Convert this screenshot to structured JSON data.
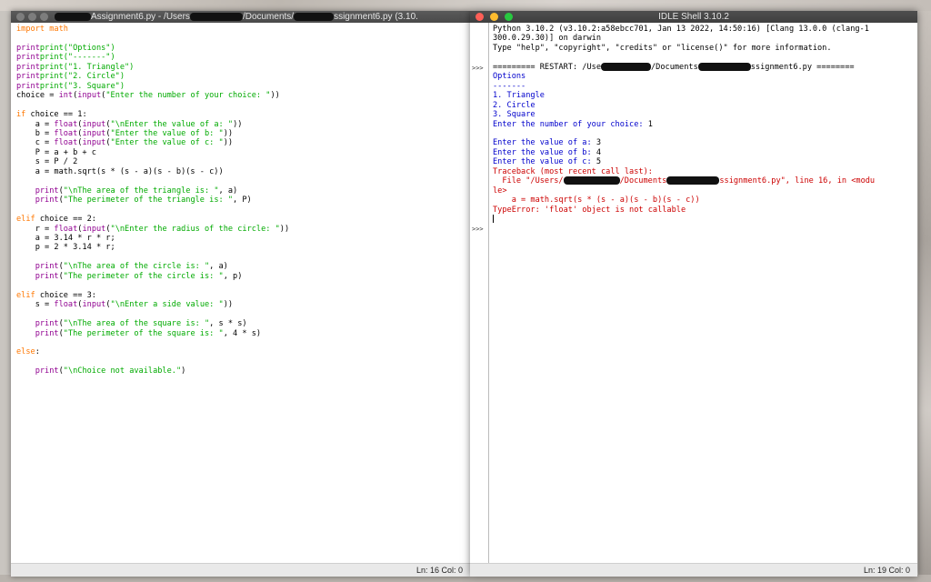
{
  "editor": {
    "title_prefix": "Assignment6.py - /Users",
    "title_mid": "/Documents/",
    "title_suffix": "ssignment6.py (3.10.",
    "status": "Ln: 16  Col: 0",
    "code": {
      "l1": "import math",
      "l2": "print(\"Options\")",
      "l3": "print(\"-------\")",
      "l4": "print(\"1. Triangle\")",
      "l5": "print(\"2. Circle\")",
      "l6": "print(\"3. Square\")",
      "l7_pre": "choice = ",
      "l7_str": "\"Enter the number of your choice: \"",
      "l7_post": "))",
      "l8_cond": " choice == 1:",
      "l9_pre": "    a = ",
      "l9_str": "\"\\nEnter the value of a: \"",
      "l10_pre": "    b = ",
      "l10_str": "\"Enter the value of b: \"",
      "l11_pre": "    c = ",
      "l11_str": "\"Enter the value of c: \"",
      "l12": "    P = a + b + c",
      "l13": "    s = P / 2",
      "l14": "    a = math.sqrt(s * (s - a)(s - b)(s - c))",
      "l15_str": "\"\\nThe area of the triangle is: \"",
      "l15_post": ", a)",
      "l16_str": "\"The perimeter of the triangle is: \"",
      "l16_post": ", P)",
      "l17_cond": " choice == 2:",
      "l18_pre": "    r = ",
      "l18_str": "\"\\nEnter the radius of the circle: \"",
      "l19": "    a = 3.14 * r * r;",
      "l20": "    p = 2 * 3.14 * r;",
      "l21_str": "\"\\nThe area of the circle is: \"",
      "l21_post": ", a)",
      "l22_str": "\"The perimeter of the circle is: \"",
      "l22_post": ", p)",
      "l23_cond": " choice == 3:",
      "l24_pre": "    s = ",
      "l24_str": "\"\\nEnter a side value: \"",
      "l25_str": "\"\\nThe area of the square is: \"",
      "l25_post": ", s * s)",
      "l26_str": "\"The perimeter of the square is: \"",
      "l26_post": ", 4 * s)",
      "l27": "else",
      "l28_str": "\"\\nChoice not available.\"",
      "l28_post": ")"
    }
  },
  "shell": {
    "title": "IDLE Shell 3.10.2",
    "status": "Ln: 19  Col: 0",
    "prompt": ">>>",
    "banner1": "Python 3.10.2 (v3.10.2:a58ebcc701, Jan 13 2022, 14:50:16) [Clang 13.0.0 (clang-1",
    "banner2": "300.0.29.30)] on darwin",
    "banner3": "Type \"help\", \"copyright\", \"credits\" or \"license()\" for more information.",
    "restart_pre": "========= RESTART: /Use",
    "restart_mid": "/Documents",
    "restart_post": "ssignment6.py ========",
    "out1": "Options",
    "out2": "-------",
    "out3": "1. Triangle",
    "out4": "2. Circle",
    "out5": "3. Square",
    "out6": "Enter the number of your choice: ",
    "in6": "1",
    "out7": "Enter the value of a: ",
    "in7": "3",
    "out8": "Enter the value of b: ",
    "in8": "4",
    "out9": "Enter the value of c: ",
    "in9": "5",
    "err1": "Traceback (most recent call last):",
    "err2_pre": "  File \"/Users/",
    "err2_mid": "/Documents",
    "err2_post": "ssignment6.py\", line 16, in <modu",
    "err3": "le>",
    "err4": "    a = math.sqrt(s * (s - a)(s - b)(s - c))",
    "err5": "TypeError: 'float' object is not callable"
  }
}
